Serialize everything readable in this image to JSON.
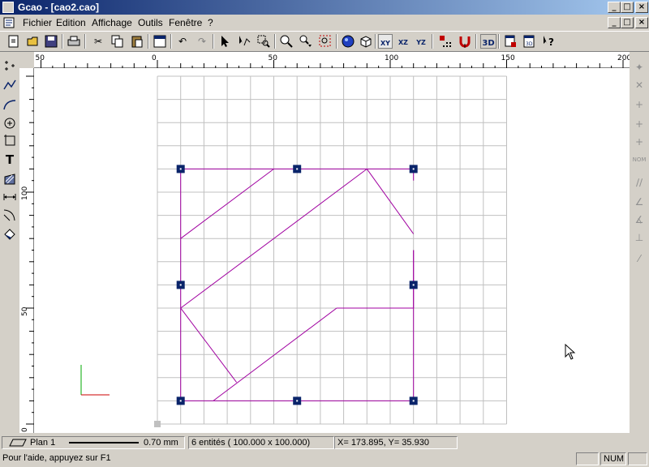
{
  "window": {
    "title": "Gcao - [cao2.cao]"
  },
  "window_controls": {
    "minimize": "_",
    "maximize": "□",
    "close": "×"
  },
  "menu": {
    "items": [
      "Fichier",
      "Edition",
      "Affichage",
      "Outils",
      "Fenêtre",
      "?"
    ]
  },
  "toolbar": {
    "buttons": [
      "new-icon",
      "open-icon",
      "save-icon",
      "print-icon",
      "cut-icon",
      "copy-icon",
      "paste-icon",
      "properties-icon",
      "undo-icon",
      "redo-icon",
      "select-arrow-icon",
      "select-node-icon",
      "zoom-window-icon",
      "zoom-icon",
      "zoom-dynamic-icon",
      "zoom-all-icon",
      "sphere-icon",
      "cube-icon",
      "plane-xy-icon",
      "plane-xz-icon",
      "plane-yz-icon",
      "grid-snap-icon",
      "magnet-icon",
      "view-3d-icon",
      "print-preview-icon",
      "export-3d-icon",
      "help-pointer-icon"
    ],
    "labels": {
      "xy": "XY",
      "xz": "XZ",
      "yz": "YZ",
      "three_d": "3D"
    }
  },
  "left_tools": [
    "point-tool-icon",
    "polyline-tool-icon",
    "curve-tool-icon",
    "circle-tool-icon",
    "rectangle-tool-icon",
    "text-tool-icon",
    "hatch-tool-icon",
    "dimension-tool-icon",
    "arc-tool-icon",
    "fill-tool-icon"
  ],
  "right_tools": {
    "items": [
      "snap-point-icon",
      "snap-cross-icon",
      "snap-end-icon",
      "snap-mid-icon",
      "snap-center-icon",
      "snap-nom-icon",
      "snap-parallel-icon",
      "snap-angle-icon",
      "snap-perpendicular-icon",
      "snap-tangent-icon",
      "snap-extend-icon"
    ],
    "nom_label": "NOM"
  },
  "rulers": {
    "horizontal": [
      {
        "label": "50",
        "value": -50
      },
      {
        "label": "0",
        "value": 0
      },
      {
        "label": "50",
        "value": 50
      },
      {
        "label": "100",
        "value": 100
      },
      {
        "label": "150",
        "value": 150
      },
      {
        "label": "200",
        "value": 200
      }
    ],
    "vertical": [
      {
        "label": "100",
        "value": 100
      },
      {
        "label": "50",
        "value": 50
      },
      {
        "label": "0",
        "value": 0
      }
    ]
  },
  "colors": {
    "selection": "#0a246a",
    "shape": "#a000a0",
    "grid": "#c0c0c0",
    "axis_x": "#cc0000",
    "axis_y": "#00aa00",
    "titlebar_start": "#0a246a",
    "titlebar_end": "#a6caf0"
  },
  "status": {
    "plane": "Plan 1",
    "line_width": "0.70 mm",
    "entities": "6 entités ( 100.000 x  100.000)",
    "coords": "X=  173.895, Y=    35.930",
    "help": "Pour l'aide, appuyez sur F1",
    "num": "NUM"
  }
}
